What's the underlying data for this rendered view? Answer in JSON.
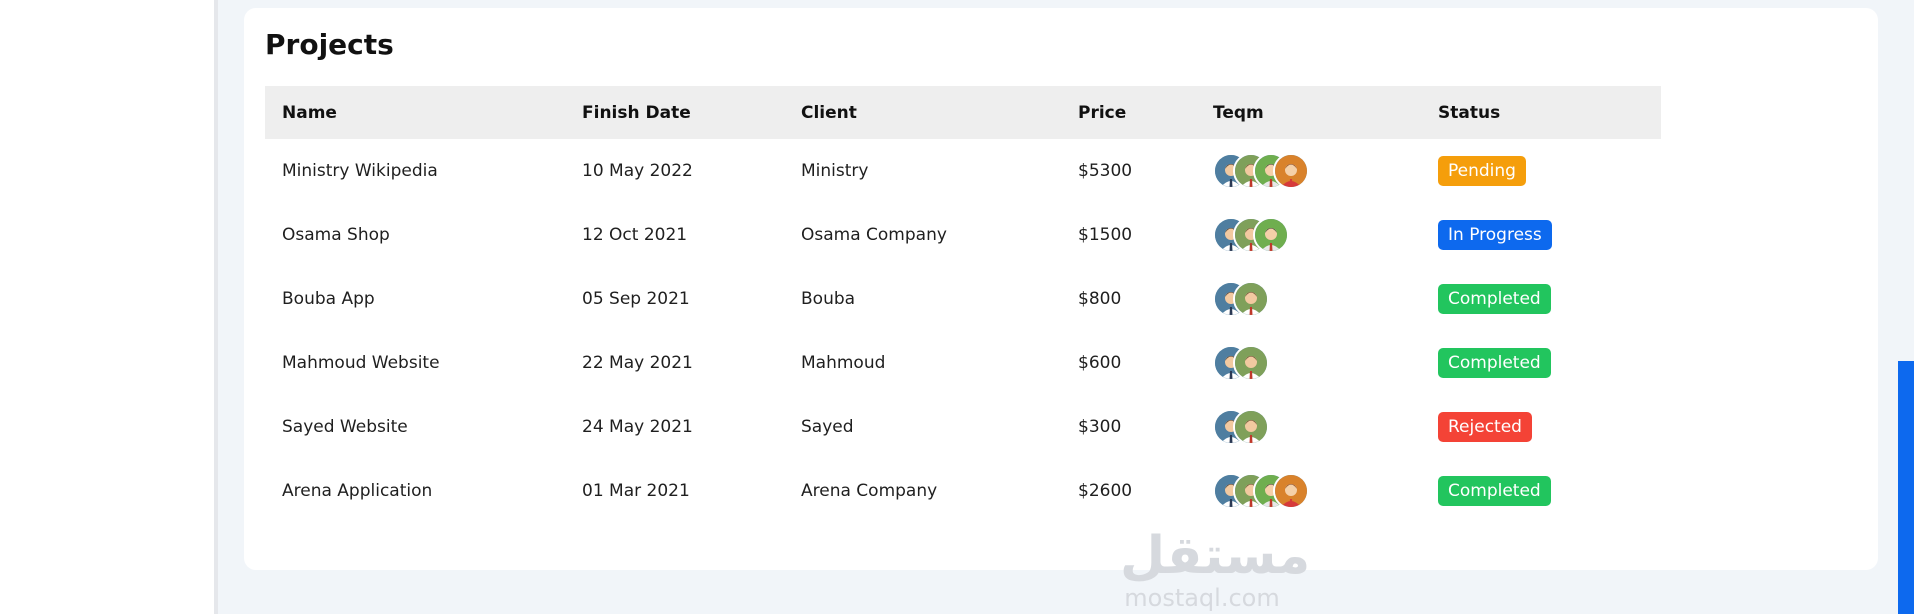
{
  "card": {
    "title": "Projects"
  },
  "table": {
    "headers": [
      "Name",
      "Finish Date",
      "Client",
      "Price",
      "Teqm",
      "Status"
    ],
    "rows": [
      {
        "name": "Ministry Wikipedia",
        "date": "10 May 2022",
        "client": "Ministry",
        "price": "$5300",
        "team_size": 4,
        "status": "Pending",
        "status_color": "#f59e0b"
      },
      {
        "name": "Osama Shop",
        "date": "12 Oct 2021",
        "client": "Osama Company",
        "price": "$1500",
        "team_size": 3,
        "status": "In Progress",
        "status_color": "#0d69ee"
      },
      {
        "name": "Bouba App",
        "date": "05 Sep 2021",
        "client": "Bouba",
        "price": "$800",
        "team_size": 2,
        "status": "Completed",
        "status_color": "#22c55e"
      },
      {
        "name": "Mahmoud Website",
        "date": "22 May 2021",
        "client": "Mahmoud",
        "price": "$600",
        "team_size": 2,
        "status": "Completed",
        "status_color": "#22c55e"
      },
      {
        "name": "Sayed Website",
        "date": "24 May 2021",
        "client": "Sayed",
        "price": "$300",
        "team_size": 2,
        "status": "Rejected",
        "status_color": "#f44336"
      },
      {
        "name": "Arena Application",
        "date": "01 Mar 2021",
        "client": "Arena Company",
        "price": "$2600",
        "team_size": 4,
        "status": "Completed",
        "status_color": "#22c55e"
      }
    ]
  },
  "watermark": {
    "arabic": "مستقل",
    "latin": "mostaql.com"
  },
  "colors": {
    "accent": "#0d69ee",
    "background": "#f1f5f9"
  },
  "icons": [
    "avatar-icon"
  ]
}
